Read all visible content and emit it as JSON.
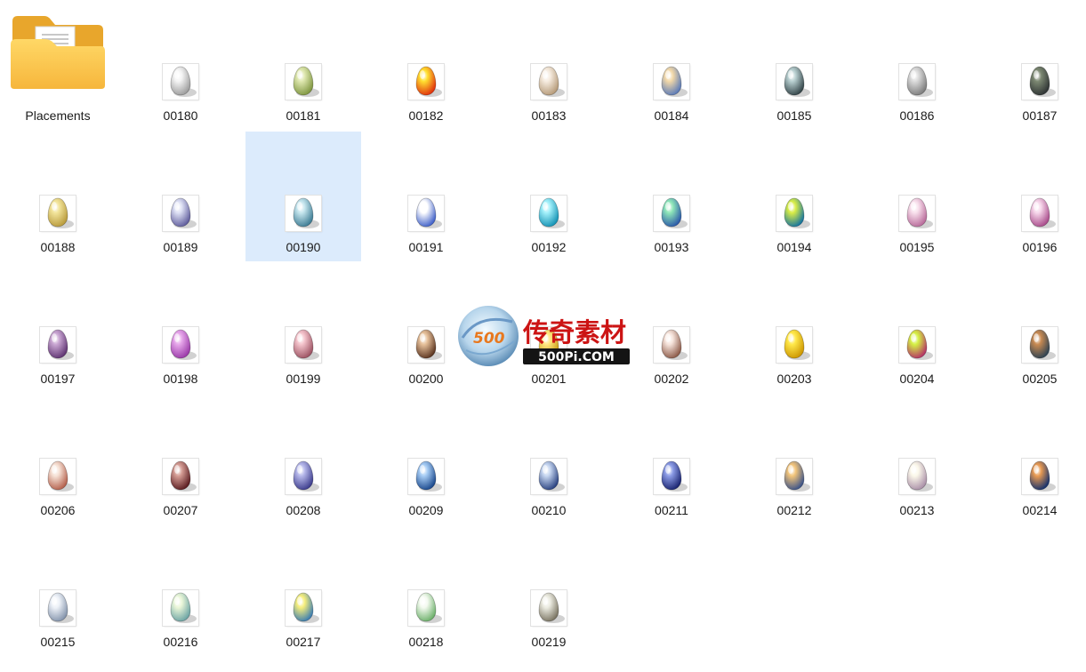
{
  "folder": {
    "label": "Placements",
    "icon": "folder-icon"
  },
  "files": [
    {
      "name": "00180",
      "c1": "#f4f4f4",
      "c2": "#9c9c9c"
    },
    {
      "name": "00181",
      "c1": "#dfe8b0",
      "c2": "#7f9640"
    },
    {
      "name": "00182",
      "c1": "#ffdf30",
      "c2": "#e0300c"
    },
    {
      "name": "00183",
      "c1": "#f6ece0",
      "c2": "#b59a78"
    },
    {
      "name": "00184",
      "c1": "#f2d8a8",
      "c2": "#5a7ab8"
    },
    {
      "name": "00185",
      "c1": "#b8cfd0",
      "c2": "#334448"
    },
    {
      "name": "00186",
      "c1": "#dcdcdc",
      "c2": "#7c7c7c"
    },
    {
      "name": "00187",
      "c1": "#7c8872",
      "c2": "#2f3434"
    },
    {
      "name": "00188",
      "c1": "#f2e49a",
      "c2": "#b89a3c"
    },
    {
      "name": "00189",
      "c1": "#dde0f4",
      "c2": "#5f5c9c"
    },
    {
      "name": "00190",
      "c1": "#c6e6ee",
      "c2": "#3d7c94"
    },
    {
      "name": "00191",
      "c1": "#ffffff",
      "c2": "#3e5fc8"
    },
    {
      "name": "00192",
      "c1": "#a2f0fa",
      "c2": "#1492b4"
    },
    {
      "name": "00193",
      "c1": "#8ee6b8",
      "c2": "#2a58a8"
    },
    {
      "name": "00194",
      "c1": "#d8ec46",
      "c2": "#1474a0"
    },
    {
      "name": "00195",
      "c1": "#f8e0ec",
      "c2": "#b86a9a"
    },
    {
      "name": "00196",
      "c1": "#f6d6ea",
      "c2": "#a84a8a"
    },
    {
      "name": "00197",
      "c1": "#c9a6d2",
      "c2": "#5f3472"
    },
    {
      "name": "00198",
      "c1": "#e6a6ea",
      "c2": "#9a3aa8"
    },
    {
      "name": "00199",
      "c1": "#f4c4cc",
      "c2": "#9c5262"
    },
    {
      "name": "00200",
      "c1": "#e6c09a",
      "c2": "#5a3420"
    },
    {
      "name": "00201",
      "c1": "#ffe680",
      "c2": "#c89a10"
    },
    {
      "name": "00202",
      "c1": "#f6e4dc",
      "c2": "#8c5a48"
    },
    {
      "name": "00203",
      "c1": "#ffe84a",
      "c2": "#cc9600"
    },
    {
      "name": "00204",
      "c1": "#d4f044",
      "c2": "#b43266"
    },
    {
      "name": "00205",
      "c1": "#c88a52",
      "c2": "#2e4252"
    },
    {
      "name": "00206",
      "c1": "#f6e2d6",
      "c2": "#b4604c"
    },
    {
      "name": "00207",
      "c1": "#d49c94",
      "c2": "#5a1c20"
    },
    {
      "name": "00208",
      "c1": "#b6b8ea",
      "c2": "#3c3c8c"
    },
    {
      "name": "00209",
      "c1": "#a6ccf4",
      "c2": "#1a488c"
    },
    {
      "name": "00210",
      "c1": "#c6d6f0",
      "c2": "#2a4280"
    },
    {
      "name": "00211",
      "c1": "#8c9ce6",
      "c2": "#1a2470"
    },
    {
      "name": "00212",
      "c1": "#f2c47a",
      "c2": "#3a5288"
    },
    {
      "name": "00213",
      "c1": "#fbf8ea",
      "c2": "#aa90a8"
    },
    {
      "name": "00214",
      "c1": "#e89a52",
      "c2": "#14306c"
    },
    {
      "name": "00215",
      "c1": "#eef2f8",
      "c2": "#8494ac"
    },
    {
      "name": "00216",
      "c1": "#eaf6d8",
      "c2": "#6ca4a4"
    },
    {
      "name": "00217",
      "c1": "#f6ee7c",
      "c2": "#3a7cb0"
    },
    {
      "name": "00218",
      "c1": "#f4faf0",
      "c2": "#6cb06a"
    },
    {
      "name": "00219",
      "c1": "#ecece2",
      "c2": "#7a7462"
    }
  ],
  "selected": "00190",
  "watermark": {
    "text_cn": "传奇素材",
    "text_en": "500Pi.COM",
    "badge": "500"
  }
}
